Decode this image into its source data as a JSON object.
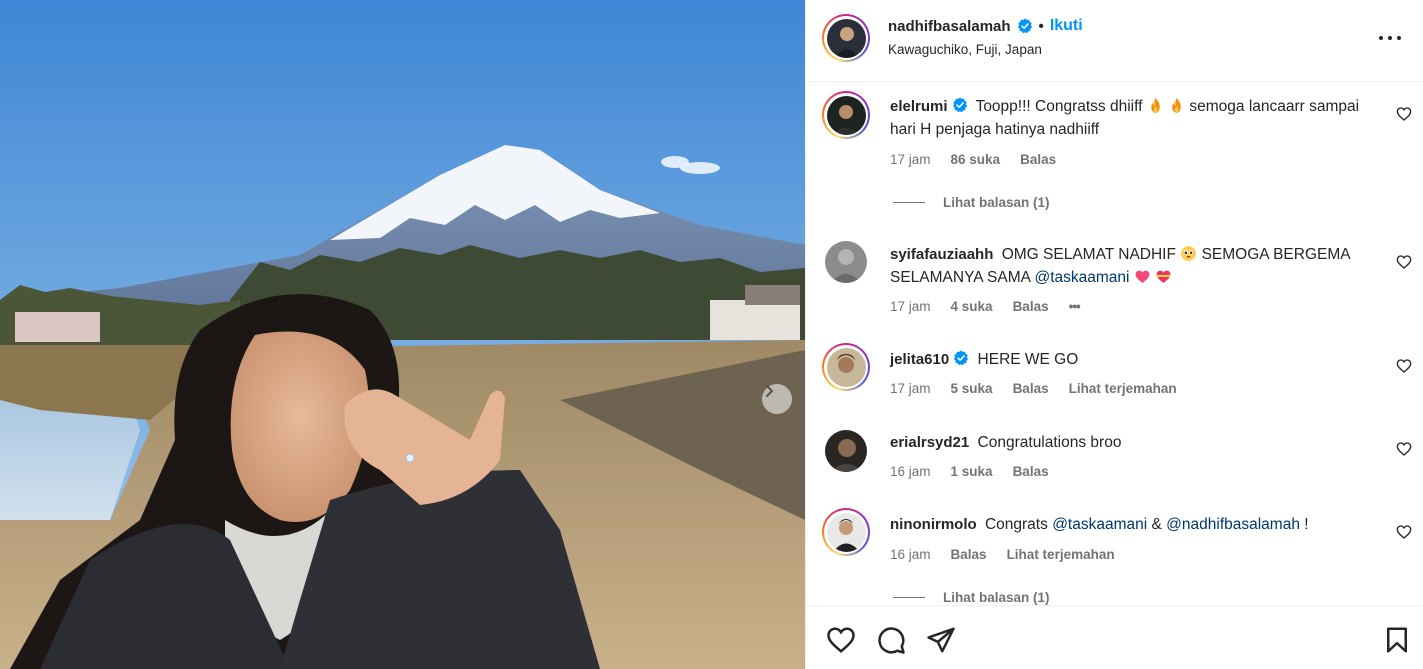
{
  "post": {
    "author": "nadhifbasalamah",
    "follow_label": "Ikuti",
    "separator": "•",
    "location": "Kawaguchiko, Fuji, Japan",
    "more_icon": "more-horizontal-icon"
  },
  "media": {
    "alt_scene": "Woman showing engagement ring in front of Mount Fuji",
    "next_icon": "chevron-right-icon"
  },
  "comments": [
    {
      "user": "elelrumi",
      "verified": true,
      "text_a": "Toopp!!! Congratss dhiiff",
      "text_b": "semoga lancaarr sampai hari H penjaga hatinya nadhiiff",
      "time": "17 jam",
      "likes": "86 suka",
      "reply": "Balas",
      "view_replies": "Lihat balasan (1)"
    },
    {
      "user": "syifafauziaahh",
      "verified": false,
      "text_a": "OMG SELAMAT NADHIF",
      "text_b": "SEMOGA BERGEMA SELAMANYA SAMA",
      "mention": "@taskaamani",
      "time": "17 jam",
      "likes": "4 suka",
      "reply": "Balas",
      "more": "•••"
    },
    {
      "user": "jelita610",
      "verified": true,
      "text": "HERE WE GO",
      "time": "17 jam",
      "likes": "5 suka",
      "reply": "Balas",
      "translate": "Lihat terjemahan"
    },
    {
      "user": "erialrsyd21",
      "verified": false,
      "text": "Congratulations broo",
      "time": "16 jam",
      "likes": "1 suka",
      "reply": "Balas"
    },
    {
      "user": "ninonirmolo",
      "verified": false,
      "text_a": "Congrats",
      "mention_a": "@taskaamani",
      "amp": "&",
      "mention_b": "@nadhifbasalamah",
      "tail": "!",
      "time": "16 jam",
      "reply": "Balas",
      "translate": "Lihat terjemahan",
      "view_replies": "Lihat balasan (1)"
    }
  ],
  "actions": {
    "like_icon": "heart-icon",
    "comment_icon": "comment-icon",
    "share_icon": "send-icon",
    "save_icon": "bookmark-icon"
  },
  "colors": {
    "link": "#0095f6",
    "mention": "#00376b",
    "secondary_text": "#737373",
    "verified": "#0095f6"
  }
}
